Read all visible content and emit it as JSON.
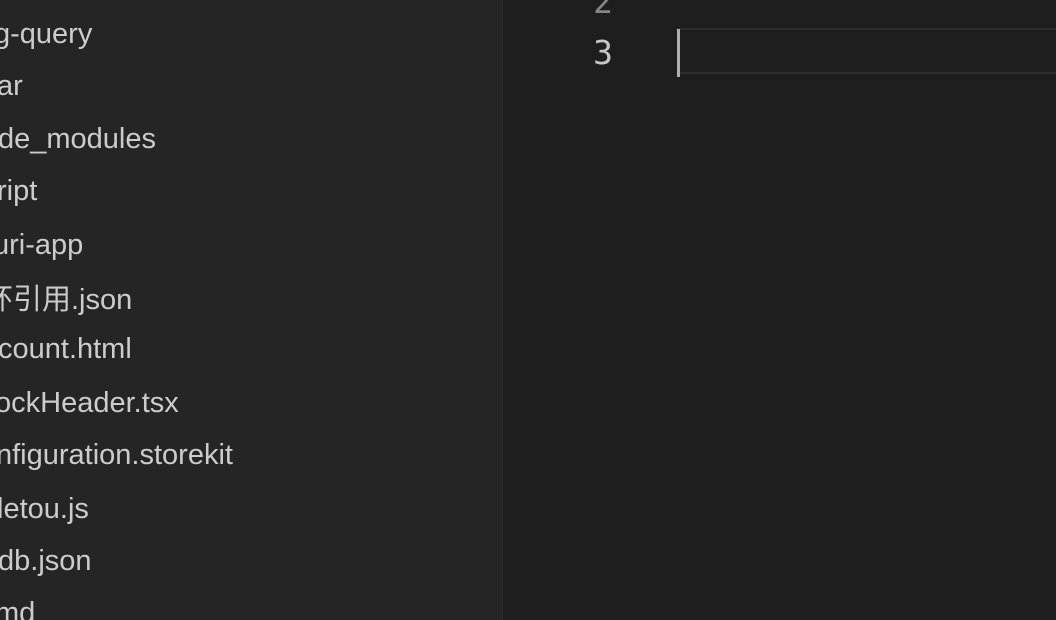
{
  "explorer": {
    "items": [
      {
        "label": "g-query"
      },
      {
        "label": "ar"
      },
      {
        "label": "de_modules"
      },
      {
        "label": "ript"
      },
      {
        "label": "uri-app"
      },
      {
        "label": "环引用.json"
      },
      {
        "label": "count.html"
      },
      {
        "label": "ockHeader.tsx"
      },
      {
        "label": "nfiguration.storekit"
      },
      {
        "label": "letou.js"
      },
      {
        "label": "db.json"
      },
      {
        "label": "md"
      }
    ]
  },
  "editor": {
    "line_numbers": [
      "2",
      "3"
    ],
    "active_line": "3",
    "colors": {
      "active_line_number": "#c6c6c6",
      "inactive_line_number": "#858585",
      "cursor": "#aeafad",
      "sidebar_background": "#252526",
      "editor_background": "#1e1e1e",
      "text": "#cccccc"
    }
  }
}
